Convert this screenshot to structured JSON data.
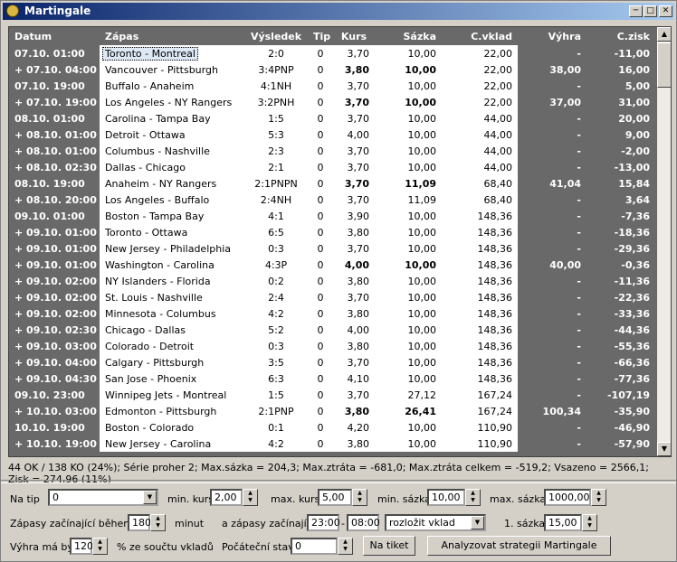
{
  "window": {
    "title": "Martingale"
  },
  "columns": [
    "Datum",
    "Zápas",
    "Výsledek",
    "Tip",
    "Kurs",
    "Sázka",
    "C.vklad",
    "Výhra",
    "C.zisk"
  ],
  "rows": [
    {
      "datum": "07.10. 01:00",
      "zapas": "Toronto - Montreal",
      "vysledek": "2:0",
      "tip": "0",
      "kurs": "3,70",
      "sazka": "10,00",
      "cvklad": "22,00",
      "vyhra": "-",
      "czisk": "-11,00",
      "bold": false
    },
    {
      "datum": "+ 07.10. 04:00",
      "zapas": "Vancouver - Pittsburgh",
      "vysledek": "3:4PNP",
      "tip": "0",
      "kurs": "3,80",
      "sazka": "10,00",
      "cvklad": "22,00",
      "vyhra": "38,00",
      "czisk": "16,00",
      "bold": true
    },
    {
      "datum": "07.10. 19:00",
      "zapas": "Buffalo - Anaheim",
      "vysledek": "4:1NH",
      "tip": "0",
      "kurs": "3,70",
      "sazka": "10,00",
      "cvklad": "22,00",
      "vyhra": "-",
      "czisk": "5,00",
      "bold": false
    },
    {
      "datum": "+ 07.10. 19:00",
      "zapas": "Los Angeles - NY Rangers",
      "vysledek": "3:2PNH",
      "tip": "0",
      "kurs": "3,70",
      "sazka": "10,00",
      "cvklad": "22,00",
      "vyhra": "37,00",
      "czisk": "31,00",
      "bold": true
    },
    {
      "datum": "08.10. 01:00",
      "zapas": "Carolina - Tampa Bay",
      "vysledek": "1:5",
      "tip": "0",
      "kurs": "3,70",
      "sazka": "10,00",
      "cvklad": "44,00",
      "vyhra": "-",
      "czisk": "20,00",
      "bold": false
    },
    {
      "datum": "+ 08.10. 01:00",
      "zapas": "Detroit - Ottawa",
      "vysledek": "5:3",
      "tip": "0",
      "kurs": "4,00",
      "sazka": "10,00",
      "cvklad": "44,00",
      "vyhra": "-",
      "czisk": "9,00",
      "bold": false
    },
    {
      "datum": "+ 08.10. 01:00",
      "zapas": "Columbus - Nashville",
      "vysledek": "2:3",
      "tip": "0",
      "kurs": "3,70",
      "sazka": "10,00",
      "cvklad": "44,00",
      "vyhra": "-",
      "czisk": "-2,00",
      "bold": false
    },
    {
      "datum": "+ 08.10. 02:30",
      "zapas": "Dallas - Chicago",
      "vysledek": "2:1",
      "tip": "0",
      "kurs": "3,70",
      "sazka": "10,00",
      "cvklad": "44,00",
      "vyhra": "-",
      "czisk": "-13,00",
      "bold": false
    },
    {
      "datum": "08.10. 19:00",
      "zapas": "Anaheim - NY Rangers",
      "vysledek": "2:1PNPN",
      "tip": "0",
      "kurs": "3,70",
      "sazka": "11,09",
      "cvklad": "68,40",
      "vyhra": "41,04",
      "czisk": "15,84",
      "bold": true
    },
    {
      "datum": "+ 08.10. 20:00",
      "zapas": "Los Angeles - Buffalo",
      "vysledek": "2:4NH",
      "tip": "0",
      "kurs": "3,70",
      "sazka": "11,09",
      "cvklad": "68,40",
      "vyhra": "-",
      "czisk": "3,64",
      "bold": false
    },
    {
      "datum": "09.10. 01:00",
      "zapas": "Boston - Tampa Bay",
      "vysledek": "4:1",
      "tip": "0",
      "kurs": "3,90",
      "sazka": "10,00",
      "cvklad": "148,36",
      "vyhra": "-",
      "czisk": "-7,36",
      "bold": false
    },
    {
      "datum": "+ 09.10. 01:00",
      "zapas": "Toronto - Ottawa",
      "vysledek": "6:5",
      "tip": "0",
      "kurs": "3,80",
      "sazka": "10,00",
      "cvklad": "148,36",
      "vyhra": "-",
      "czisk": "-18,36",
      "bold": false
    },
    {
      "datum": "+ 09.10. 01:00",
      "zapas": "New Jersey - Philadelphia",
      "vysledek": "0:3",
      "tip": "0",
      "kurs": "3,70",
      "sazka": "10,00",
      "cvklad": "148,36",
      "vyhra": "-",
      "czisk": "-29,36",
      "bold": false
    },
    {
      "datum": "+ 09.10. 01:00",
      "zapas": "Washington - Carolina",
      "vysledek": "4:3P",
      "tip": "0",
      "kurs": "4,00",
      "sazka": "10,00",
      "cvklad": "148,36",
      "vyhra": "40,00",
      "czisk": "-0,36",
      "bold": true
    },
    {
      "datum": "+ 09.10. 02:00",
      "zapas": "NY Islanders - Florida",
      "vysledek": "0:2",
      "tip": "0",
      "kurs": "3,80",
      "sazka": "10,00",
      "cvklad": "148,36",
      "vyhra": "-",
      "czisk": "-11,36",
      "bold": false
    },
    {
      "datum": "+ 09.10. 02:00",
      "zapas": "St. Louis - Nashville",
      "vysledek": "2:4",
      "tip": "0",
      "kurs": "3,70",
      "sazka": "10,00",
      "cvklad": "148,36",
      "vyhra": "-",
      "czisk": "-22,36",
      "bold": false
    },
    {
      "datum": "+ 09.10. 02:00",
      "zapas": "Minnesota - Columbus",
      "vysledek": "4:2",
      "tip": "0",
      "kurs": "3,80",
      "sazka": "10,00",
      "cvklad": "148,36",
      "vyhra": "-",
      "czisk": "-33,36",
      "bold": false
    },
    {
      "datum": "+ 09.10. 02:30",
      "zapas": "Chicago - Dallas",
      "vysledek": "5:2",
      "tip": "0",
      "kurs": "4,00",
      "sazka": "10,00",
      "cvklad": "148,36",
      "vyhra": "-",
      "czisk": "-44,36",
      "bold": false
    },
    {
      "datum": "+ 09.10. 03:00",
      "zapas": "Colorado - Detroit",
      "vysledek": "0:3",
      "tip": "0",
      "kurs": "3,80",
      "sazka": "10,00",
      "cvklad": "148,36",
      "vyhra": "-",
      "czisk": "-55,36",
      "bold": false
    },
    {
      "datum": "+ 09.10. 04:00",
      "zapas": "Calgary - Pittsburgh",
      "vysledek": "3:5",
      "tip": "0",
      "kurs": "3,70",
      "sazka": "10,00",
      "cvklad": "148,36",
      "vyhra": "-",
      "czisk": "-66,36",
      "bold": false
    },
    {
      "datum": "+ 09.10. 04:30",
      "zapas": "San Jose - Phoenix",
      "vysledek": "6:3",
      "tip": "0",
      "kurs": "4,10",
      "sazka": "10,00",
      "cvklad": "148,36",
      "vyhra": "-",
      "czisk": "-77,36",
      "bold": false
    },
    {
      "datum": "09.10. 23:00",
      "zapas": "Winnipeg Jets - Montreal",
      "vysledek": "1:5",
      "tip": "0",
      "kurs": "3,70",
      "sazka": "27,12",
      "cvklad": "167,24",
      "vyhra": "-",
      "czisk": "-107,19",
      "bold": false
    },
    {
      "datum": "+ 10.10. 03:00",
      "zapas": "Edmonton - Pittsburgh",
      "vysledek": "2:1PNP",
      "tip": "0",
      "kurs": "3,80",
      "sazka": "26,41",
      "cvklad": "167,24",
      "vyhra": "100,34",
      "czisk": "-35,90",
      "bold": true
    },
    {
      "datum": "10.10. 19:00",
      "zapas": "Boston - Colorado",
      "vysledek": "0:1",
      "tip": "0",
      "kurs": "4,20",
      "sazka": "10,00",
      "cvklad": "110,90",
      "vyhra": "-",
      "czisk": "-46,90",
      "bold": false
    },
    {
      "datum": "+ 10.10. 19:00",
      "zapas": "New Jersey - Carolina",
      "vysledek": "4:2",
      "tip": "0",
      "kurs": "3,80",
      "sazka": "10,00",
      "cvklad": "110,90",
      "vyhra": "-",
      "czisk": "-57,90",
      "bold": false
    }
  ],
  "status": "44 OK / 138 KO (24%); Série proher 2; Max.sázka = 204,3; Max.ztráta = -681,0; Max.ztráta celkem = -519,2; Vsazeno = 2566,1; Zisk = 274,96 (11%)",
  "form": {
    "na_tip_label": "Na tip",
    "na_tip_value": "0",
    "min_kurs_label": "min. kurs",
    "min_kurs_value": "2,00",
    "max_kurs_label": "max. kurs",
    "max_kurs_value": "5,00",
    "min_sazka_label": "min. sázka",
    "min_sazka_value": "10,00",
    "max_sazka_label": "max. sázka",
    "max_sazka_value": "1000,00",
    "zapasy_label": "Zápasy začínající během",
    "zapasy_value": "180",
    "minut_label": "minut",
    "a_zapasy_label": "a zápasy začínající",
    "time_from": "23:00",
    "dash": "-",
    "time_to": "08:00",
    "rozlozit_value": "rozložit vklad",
    "prvni_sazka_label": "1. sázka",
    "prvni_sazka_value": "15,00",
    "vyhra_label": "Výhra má být",
    "vyhra_value": "120",
    "procent_label": "% ze součtu vkladů",
    "pocatecni_label": "Počáteční stav",
    "pocatecni_value": "0",
    "na_tiket_button": "Na tiket",
    "analyze_button": "Analyzovat strategii Martingale"
  }
}
